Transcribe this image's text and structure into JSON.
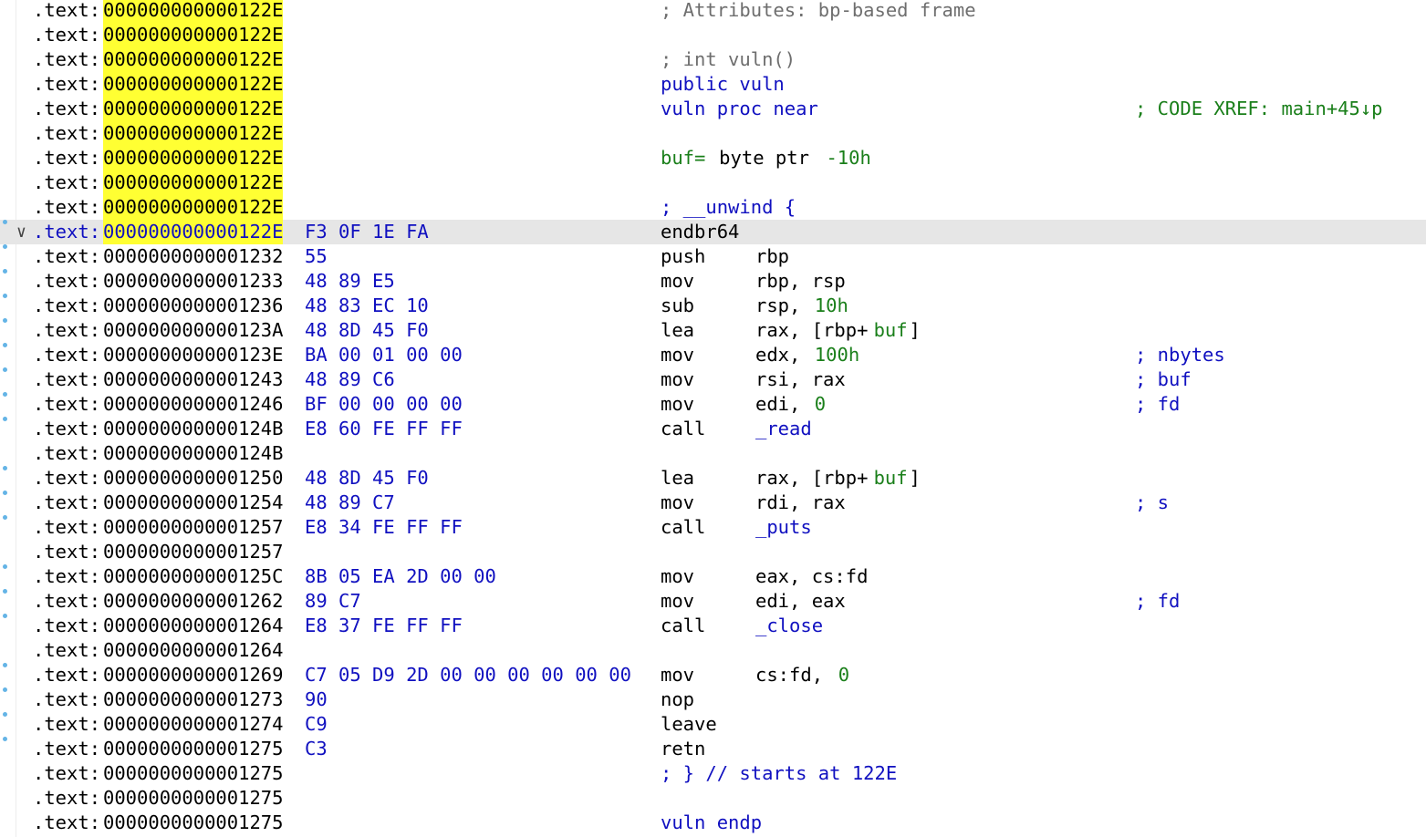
{
  "segment": ".text:",
  "colors": {
    "address_highlight": "#ffff33",
    "bytes": "#1010c0",
    "comment_gray": "#6e6e6e",
    "keyword_blue": "#1010c0",
    "number_green": "#1a7f1a",
    "current_line": "#e6e6e6",
    "breakpoint_dot": "#64b4e6"
  },
  "lines": [
    {
      "addr": "000000000000122E",
      "highlight": true,
      "comment": "; Attributes: bp-based frame"
    },
    {
      "addr": "000000000000122E",
      "highlight": true
    },
    {
      "addr": "000000000000122E",
      "highlight": true,
      "comment": "; int vuln()"
    },
    {
      "addr": "000000000000122E",
      "highlight": true,
      "text_blue": "public vuln"
    },
    {
      "addr": "000000000000122E",
      "highlight": true,
      "text_blue": "vuln proc near",
      "xref": "; CODE XREF: main+45↓p"
    },
    {
      "addr": "000000000000122E",
      "highlight": true
    },
    {
      "addr": "000000000000122E",
      "highlight": true,
      "var_name": "buf=",
      "var_rest": " byte ptr ",
      "var_value": "-10h"
    },
    {
      "addr": "000000000000122E",
      "highlight": true
    },
    {
      "addr": "000000000000122E",
      "highlight": true,
      "unwind": "; __unwind {"
    },
    {
      "addr": "000000000000122E",
      "highlight": true,
      "current": true,
      "bytes": "F3 0F 1E FA",
      "mnem": "endbr64"
    },
    {
      "addr": "0000000000001232",
      "bytes": "55",
      "mnem": "push",
      "op": "rbp"
    },
    {
      "addr": "0000000000001233",
      "bytes": "48 89 E5",
      "mnem": "mov",
      "op": "rbp, rsp"
    },
    {
      "addr": "0000000000001236",
      "bytes": "48 83 EC 10",
      "mnem": "sub",
      "op": "rsp, ",
      "op_green": "10h"
    },
    {
      "addr": "000000000000123A",
      "bytes": "48 8D 45 F0",
      "mnem": "lea",
      "op": "rax, [rbp+",
      "op_green": "buf",
      "op_tail": "]"
    },
    {
      "addr": "000000000000123E",
      "bytes": "BA 00 01 00 00",
      "mnem": "mov",
      "op": "edx, ",
      "op_green": "100h",
      "rc": "; nbytes"
    },
    {
      "addr": "0000000000001243",
      "bytes": "48 89 C6",
      "mnem": "mov",
      "op": "rsi, rax",
      "rc": "; buf"
    },
    {
      "addr": "0000000000001246",
      "bytes": "BF 00 00 00 00",
      "mnem": "mov",
      "op": "edi, ",
      "op_green": "0",
      "rc": "; fd"
    },
    {
      "addr": "000000000000124B",
      "bytes": "E8 60 FE FF FF",
      "mnem": "call",
      "op_blue": "_read"
    },
    {
      "addr": "000000000000124B"
    },
    {
      "addr": "0000000000001250",
      "bytes": "48 8D 45 F0",
      "mnem": "lea",
      "op": "rax, [rbp+",
      "op_green": "buf",
      "op_tail": "]"
    },
    {
      "addr": "0000000000001254",
      "bytes": "48 89 C7",
      "mnem": "mov",
      "op": "rdi, rax",
      "rc": "; s"
    },
    {
      "addr": "0000000000001257",
      "bytes": "E8 34 FE FF FF",
      "mnem": "call",
      "op_blue": "_puts"
    },
    {
      "addr": "0000000000001257"
    },
    {
      "addr": "000000000000125C",
      "bytes": "8B 05 EA 2D 00 00",
      "mnem": "mov",
      "op": "eax, cs:fd"
    },
    {
      "addr": "0000000000001262",
      "bytes": "89 C7",
      "mnem": "mov",
      "op": "edi, eax",
      "rc": "; fd"
    },
    {
      "addr": "0000000000001264",
      "bytes": "E8 37 FE FF FF",
      "mnem": "call",
      "op_blue": "_close"
    },
    {
      "addr": "0000000000001264"
    },
    {
      "addr": "0000000000001269",
      "bytes": "C7 05 D9 2D 00 00 00 00 00 00",
      "mnem": "mov",
      "op": "cs:fd, ",
      "op_green": "0"
    },
    {
      "addr": "0000000000001273",
      "bytes": "90",
      "mnem": "nop"
    },
    {
      "addr": "0000000000001274",
      "bytes": "C9",
      "mnem": "leave"
    },
    {
      "addr": "0000000000001275",
      "bytes": "C3",
      "mnem": "retn"
    },
    {
      "addr": "0000000000001275",
      "unwind": "; } // starts at 122E"
    },
    {
      "addr": "0000000000001275"
    },
    {
      "addr": "0000000000001275",
      "text_blue": "vuln endp"
    }
  ]
}
